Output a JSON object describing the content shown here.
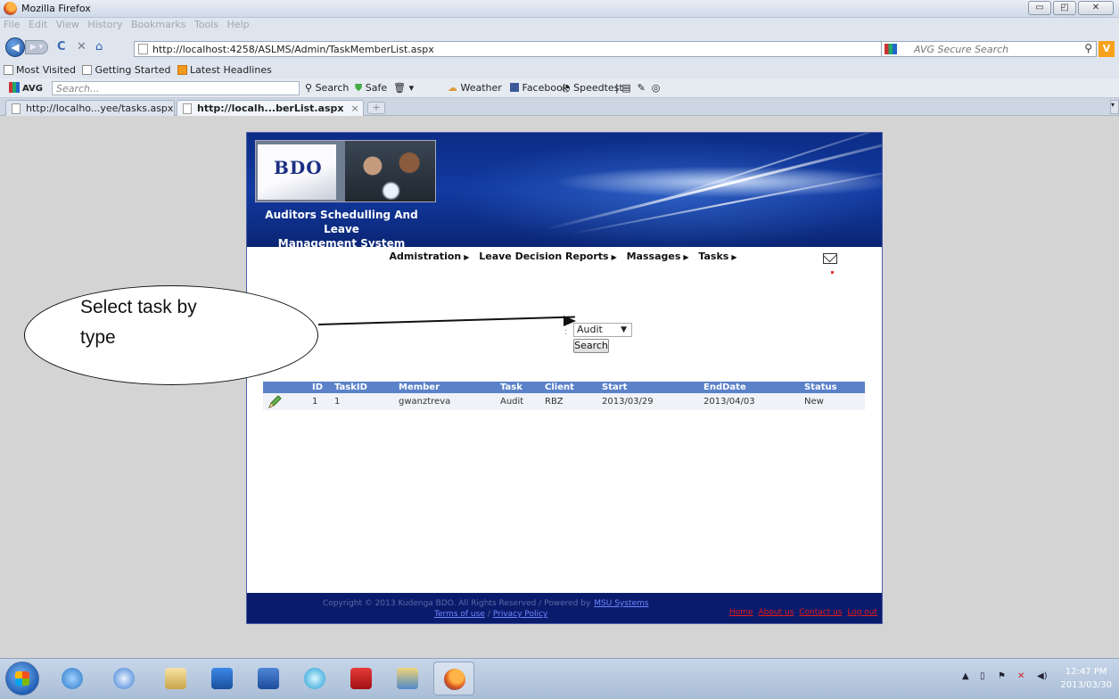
{
  "window": {
    "title": "Mozilla Firefox",
    "buttons": [
      "▭",
      "◰",
      "✕"
    ]
  },
  "menubar": [
    "File",
    "Edit",
    "View",
    "History",
    "Bookmarks",
    "Tools",
    "Help"
  ],
  "navigation": {
    "url": "http://localhost:4258/ASLMS/Admin/TaskMemberList.aspx",
    "search_placeholder": "AVG Secure Search"
  },
  "bookmarks": [
    "Most Visited",
    "Getting Started",
    "Latest Headlines"
  ],
  "avg_toolbar": {
    "brand": "AVG",
    "search_placeholder": "Search...",
    "items": [
      "Search",
      "Safe",
      "Weather",
      "Facebook",
      "Speedtest"
    ]
  },
  "tabs": [
    {
      "label": "http://localho...yee/tasks.aspx",
      "active": false
    },
    {
      "label": "http://localh...berList.aspx",
      "active": true
    }
  ],
  "site": {
    "logo_text": "BDO",
    "title_line1": "Auditors Schedulling And Leave",
    "title_line2": "Management System",
    "menu": [
      "Admistration",
      "Leave Decision Reports",
      "Massages",
      "Tasks"
    ]
  },
  "filter": {
    "colon": ":",
    "selected_type": "Audit",
    "search_label": "Search"
  },
  "table": {
    "columns": [
      "ID",
      "TaskID",
      "Member",
      "Task",
      "Client",
      "Start",
      "EndDate",
      "Status"
    ],
    "rows": [
      [
        "1",
        "1",
        "gwanztreva",
        "Audit",
        "RBZ",
        "2013/03/29",
        "2013/04/03",
        "New"
      ]
    ]
  },
  "footer": {
    "copyright": "Copyright © 2013 Kudenga BDO. All Rights Reserved / Powered by",
    "powered_by": "MSU Systems",
    "terms": "Terms of use",
    "separator": "/",
    "privacy": "Privacy Policy",
    "links": [
      "Home",
      "About us",
      "Contact us",
      "Log out"
    ]
  },
  "annotation": {
    "line1": "Select task by",
    "line2": "type"
  },
  "taskbar": {
    "time": "12:47 PM",
    "date": "2013/03/30"
  },
  "colors": {
    "banner": "#123aa1",
    "table_header": "#5b82c8",
    "footer_bg": "#0b1b6b",
    "footer_links": "#e51a1a"
  }
}
